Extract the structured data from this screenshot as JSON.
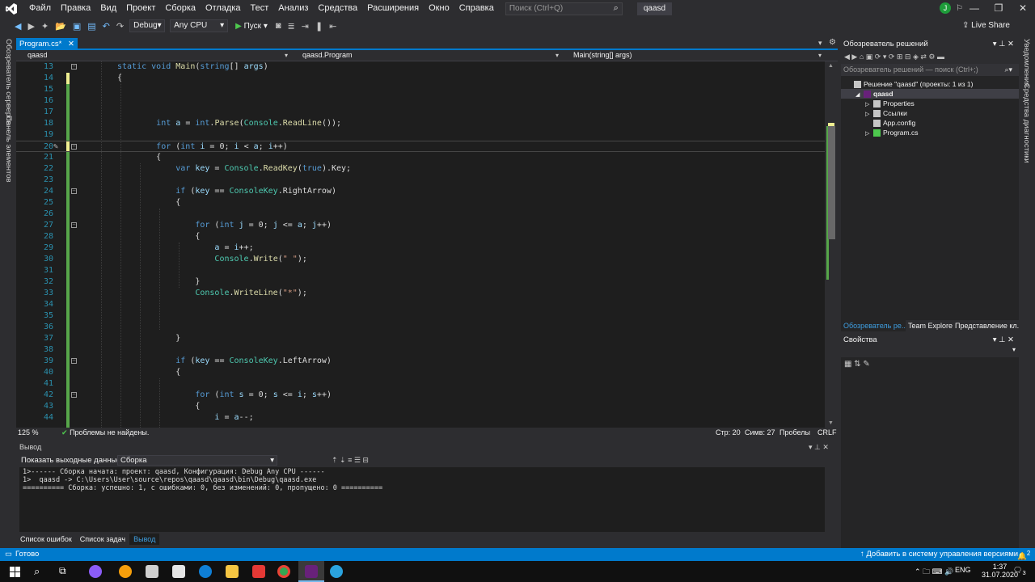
{
  "menu": {
    "items": [
      "Файл",
      "Правка",
      "Вид",
      "Проект",
      "Сборка",
      "Отладка",
      "Тест",
      "Анализ",
      "Средства",
      "Расширения",
      "Окно",
      "Справка"
    ],
    "search_placeholder": "Поиск (Ctrl+Q)",
    "solution_name": "qaasd",
    "account_initial": "J"
  },
  "toolbar": {
    "config": "Debug",
    "platform": "Any CPU",
    "run_label": "Пуск",
    "live_share": "Live Share"
  },
  "left_sidebar": {
    "items": [
      "Обозреватель серверов",
      "Панель элементов"
    ]
  },
  "right_sidebar": {
    "items": [
      "Уведомления",
      "Средства диагностики"
    ]
  },
  "editor": {
    "tab_label": "Program.cs*",
    "nav_project": "qaasd",
    "nav_class": "qaasd.Program",
    "nav_member": "Main(string[] args)",
    "zoom": "125 %",
    "problems": "Проблемы не найдены.",
    "line_col": "Стр: 20",
    "char_col": "Симв: 27",
    "whitespace": "Пробелы",
    "eol": "CRLF",
    "lines": [
      {
        "n": "13",
        "html": "<span class='kw'>static</span> <span class='kw'>void</span> <span class='fn'>Main</span>(<span class='kw'>string</span>[] <span class='pm'>args</span>)"
      },
      {
        "n": "14",
        "html": "{"
      },
      {
        "n": "15",
        "html": ""
      },
      {
        "n": "16",
        "html": ""
      },
      {
        "n": "17",
        "html": ""
      },
      {
        "n": "18",
        "html": "        <span class='kw'>int</span> <span class='pm'>a</span> = <span class='kw'>int</span>.<span class='fn'>Parse</span>(<span class='ty'>Console</span>.<span class='fn'>ReadLine</span>());"
      },
      {
        "n": "19",
        "html": ""
      },
      {
        "n": "20",
        "html": "        <span class='kw'>for</span> (<span class='kw'>int</span> <span class='pm'>i</span> = 0; <span class='pm'>i</span> &lt; <span class='pm'>a</span>; <span class='pm'>i</span>++)"
      },
      {
        "n": "21",
        "html": "        {"
      },
      {
        "n": "22",
        "html": "            <span class='kw'>var</span> <span class='pm'>key</span> = <span class='ty'>Console</span>.<span class='fn'>ReadKey</span>(<span class='kw'>true</span>).Key;"
      },
      {
        "n": "23",
        "html": ""
      },
      {
        "n": "24",
        "html": "            <span class='kw'>if</span> (<span class='pm'>key</span> == <span class='ty'>ConsoleKey</span>.RightArrow)"
      },
      {
        "n": "25",
        "html": "            {"
      },
      {
        "n": "26",
        "html": ""
      },
      {
        "n": "27",
        "html": "                <span class='kw'>for</span> (<span class='kw'>int</span> <span class='pm'>j</span> = 0; <span class='pm'>j</span> &lt;= <span class='pm'>a</span>; <span class='pm'>j</span>++)"
      },
      {
        "n": "28",
        "html": "                {"
      },
      {
        "n": "29",
        "html": "                    <span class='pm'>a</span> = <span class='pm'>i</span>++;"
      },
      {
        "n": "30",
        "html": "                    <span class='ty'>Console</span>.<span class='fn'>Write</span>(<span class='st'>\" \"</span>);"
      },
      {
        "n": "31",
        "html": ""
      },
      {
        "n": "32",
        "html": "                }"
      },
      {
        "n": "33",
        "html": "                <span class='ty'>Console</span>.<span class='fn'>WriteLine</span>(<span class='st'>\"*\"</span>);"
      },
      {
        "n": "34",
        "html": ""
      },
      {
        "n": "35",
        "html": ""
      },
      {
        "n": "36",
        "html": ""
      },
      {
        "n": "37",
        "html": "            }"
      },
      {
        "n": "38",
        "html": ""
      },
      {
        "n": "39",
        "html": "            <span class='kw'>if</span> (<span class='pm'>key</span> == <span class='ty'>ConsoleKey</span>.LeftArrow)"
      },
      {
        "n": "40",
        "html": "            {"
      },
      {
        "n": "41",
        "html": ""
      },
      {
        "n": "42",
        "html": "                <span class='kw'>for</span> (<span class='kw'>int</span> <span class='pm'>s</span> = 0; <span class='pm'>s</span> &lt;= <span class='pm'>i</span>; <span class='pm'>s</span>++)"
      },
      {
        "n": "43",
        "html": "                {"
      },
      {
        "n": "44",
        "html": "                    <span class='pm'>i</span> = <span class='pm'>a</span>--;"
      }
    ]
  },
  "output": {
    "title": "Вывод",
    "source_label": "Показать выходные данные из:",
    "source_value": "Сборка",
    "text": "1>------ Сборка начата: проект: qaasd, Конфигурация: Debug Any CPU ------\n1>  qaasd -> C:\\Users\\User\\source\\repos\\qaasd\\qaasd\\bin\\Debug\\qaasd.exe\n========== Сборка: успешно: 1, с ошибками: 0, без изменений: 0, пропущено: 0 ==========",
    "tabs": [
      "Список ошибок",
      "Список задач",
      "Вывод"
    ]
  },
  "solution_explorer": {
    "title": "Обозреватель решений",
    "search_placeholder": "Обозреватель решений — поиск (Ctrl+;)",
    "tree": [
      {
        "label": "Решение \"qaasd\" (проекты: 1 из 1)",
        "indent": 0
      },
      {
        "label": "qaasd",
        "indent": 1
      },
      {
        "label": "Properties",
        "indent": 2
      },
      {
        "label": "Ссылки",
        "indent": 2
      },
      {
        "label": "App.config",
        "indent": 2
      },
      {
        "label": "Program.cs",
        "indent": 2
      }
    ],
    "tabs": [
      "Обозреватель ре...",
      "Team Explorer",
      "Представление кл..."
    ]
  },
  "properties": {
    "title": "Свойства"
  },
  "statusbar": {
    "ready": "Готово",
    "source_control": "Добавить в систему управления версиями",
    "notifications": "2"
  },
  "taskbar": {
    "lang": "ENG",
    "time": "1:37",
    "date": "31.07.2020",
    "notif": "3"
  }
}
